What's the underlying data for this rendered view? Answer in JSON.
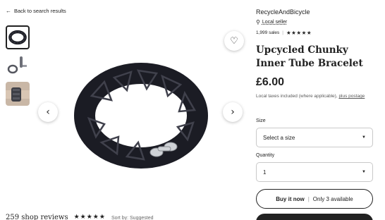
{
  "back_link": {
    "label": "Back to search results"
  },
  "shop": {
    "name": "RecycleAndBicycle",
    "local_seller": "Local seller",
    "sales": "1,999 sales",
    "stars": "★★★★★"
  },
  "listing": {
    "title": "Upcycled Chunky Inner Tube Bracelet",
    "price": "£6.00",
    "tax_note": "Local taxes included (where applicable),",
    "tax_link": "plus postage"
  },
  "size": {
    "label": "Size",
    "value": "Select a size"
  },
  "quantity": {
    "label": "Quantity",
    "value": "1"
  },
  "buy_button": {
    "label": "Buy it now",
    "availability": "Only 3 available"
  },
  "reviews_strip": {
    "text": "259 shop reviews",
    "stars": "★★★★★",
    "sort": "Sort by: Suggested"
  },
  "icons": {
    "back": "arrow-left-icon",
    "favorite": "heart-icon",
    "prev": "chevron-left-icon",
    "next": "chevron-right-icon",
    "pin": "location-pin-icon",
    "caret": "caret-down-icon"
  },
  "colors": {
    "text": "#222222",
    "muted": "#595959",
    "border": "#c9c9c9",
    "cta_dark": "#222222"
  }
}
